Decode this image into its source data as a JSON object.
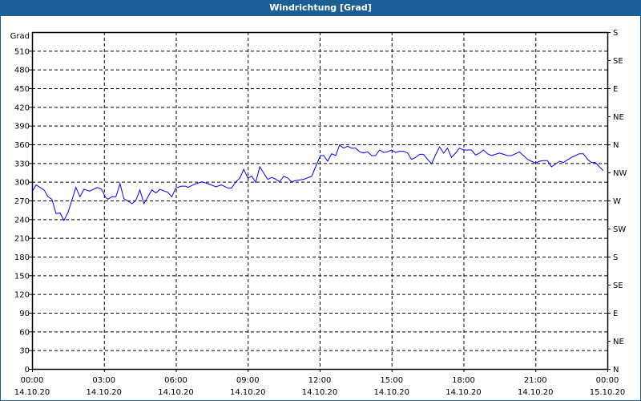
{
  "window": {
    "title": "Windrichtung [Grad]"
  },
  "chart_data": {
    "type": "line",
    "title": "Windrichtung [Grad]",
    "ylabel": "Grad",
    "ylim": [
      0,
      540
    ],
    "y_ticks": [
      0,
      30,
      60,
      90,
      120,
      150,
      180,
      210,
      240,
      270,
      300,
      330,
      360,
      390,
      420,
      450,
      480,
      510
    ],
    "right_axis": [
      {
        "value": 540,
        "label": "S"
      },
      {
        "value": 495,
        "label": "SE"
      },
      {
        "value": 450,
        "label": "E"
      },
      {
        "value": 405,
        "label": "NE"
      },
      {
        "value": 360,
        "label": "N"
      },
      {
        "value": 315,
        "label": "NW"
      },
      {
        "value": 270,
        "label": "W"
      },
      {
        "value": 225,
        "label": "SW"
      },
      {
        "value": 180,
        "label": "S"
      },
      {
        "value": 135,
        "label": "SE"
      },
      {
        "value": 90,
        "label": "E"
      },
      {
        "value": 45,
        "label": "NE"
      },
      {
        "value": 0,
        "label": "N"
      }
    ],
    "xlim_hours": [
      0,
      24
    ],
    "x_ticks": [
      {
        "hour": 0,
        "time": "00:00",
        "date": "14.10.20"
      },
      {
        "hour": 3,
        "time": "03:00",
        "date": "14.10.20"
      },
      {
        "hour": 6,
        "time": "06:00",
        "date": "14.10.20"
      },
      {
        "hour": 9,
        "time": "09:00",
        "date": "14.10.20"
      },
      {
        "hour": 12,
        "time": "12:00",
        "date": "14.10.20"
      },
      {
        "hour": 15,
        "time": "15:00",
        "date": "14.10.20"
      },
      {
        "hour": 18,
        "time": "18:00",
        "date": "14.10.20"
      },
      {
        "hour": 21,
        "time": "21:00",
        "date": "14.10.20"
      },
      {
        "hour": 24,
        "time": "00:00",
        "date": "15.10.20"
      }
    ],
    "grid": true,
    "series": [
      {
        "name": "Windrichtung",
        "color": "#0000ff",
        "points": [
          [
            0,
            284
          ],
          [
            0.17,
            295
          ],
          [
            0.33,
            291
          ],
          [
            0.5,
            287
          ],
          [
            0.67,
            276
          ],
          [
            0.83,
            272
          ],
          [
            1,
            249
          ],
          [
            1.17,
            250
          ],
          [
            1.33,
            238
          ],
          [
            1.5,
            251
          ],
          [
            1.83,
            291
          ],
          [
            2,
            276
          ],
          [
            2.17,
            288
          ],
          [
            2.4,
            285
          ],
          [
            2.73,
            291
          ],
          [
            2.9,
            288
          ],
          [
            3.07,
            275
          ],
          [
            3.17,
            272
          ],
          [
            3.33,
            276
          ],
          [
            3.5,
            276
          ],
          [
            3.67,
            297
          ],
          [
            3.83,
            273
          ],
          [
            4.17,
            265
          ],
          [
            4.33,
            270
          ],
          [
            4.5,
            287
          ],
          [
            4.67,
            265
          ],
          [
            5,
            287
          ],
          [
            5.17,
            282
          ],
          [
            5.33,
            288
          ],
          [
            5.67,
            283
          ],
          [
            5.83,
            276
          ],
          [
            6,
            290
          ],
          [
            6.23,
            293
          ],
          [
            6.4,
            293
          ],
          [
            6.5,
            291
          ],
          [
            6.77,
            296
          ],
          [
            7.1,
            300
          ],
          [
            7.33,
            297
          ],
          [
            7.67,
            292
          ],
          [
            7.9,
            295
          ],
          [
            8.17,
            290
          ],
          [
            8.33,
            290
          ],
          [
            8.5,
            300
          ],
          [
            8.67,
            306
          ],
          [
            8.83,
            320
          ],
          [
            9,
            306
          ],
          [
            9.17,
            309
          ],
          [
            9.33,
            299
          ],
          [
            9.5,
            324
          ],
          [
            9.83,
            304
          ],
          [
            10,
            307
          ],
          [
            10.17,
            304
          ],
          [
            10.33,
            300
          ],
          [
            10.5,
            309
          ],
          [
            10.67,
            306
          ],
          [
            10.83,
            300
          ],
          [
            11,
            302
          ],
          [
            11.33,
            304
          ],
          [
            11.67,
            309
          ],
          [
            11.83,
            324
          ],
          [
            12.03,
            342
          ],
          [
            12.17,
            342
          ],
          [
            12.33,
            333
          ],
          [
            12.5,
            345
          ],
          [
            12.67,
            342
          ],
          [
            12.83,
            359
          ],
          [
            13,
            354
          ],
          [
            13.17,
            357
          ],
          [
            13.33,
            354
          ],
          [
            13.5,
            354
          ],
          [
            13.67,
            348
          ],
          [
            13.83,
            346
          ],
          [
            14,
            348
          ],
          [
            14.17,
            342
          ],
          [
            14.33,
            342
          ],
          [
            14.5,
            351
          ],
          [
            14.67,
            347
          ],
          [
            14.83,
            348
          ],
          [
            15,
            351
          ],
          [
            15.17,
            347
          ],
          [
            15.33,
            349
          ],
          [
            15.5,
            349
          ],
          [
            15.67,
            346
          ],
          [
            15.83,
            336
          ],
          [
            16,
            339
          ],
          [
            16.17,
            344
          ],
          [
            16.33,
            344
          ],
          [
            16.5,
            336
          ],
          [
            16.67,
            329
          ],
          [
            16.83,
            343
          ],
          [
            17,
            356
          ],
          [
            17.17,
            346
          ],
          [
            17.33,
            354
          ],
          [
            17.5,
            339
          ],
          [
            17.67,
            346
          ],
          [
            17.83,
            354
          ],
          [
            18,
            351
          ],
          [
            18.17,
            351
          ],
          [
            18.33,
            351
          ],
          [
            18.5,
            343
          ],
          [
            18.67,
            346
          ],
          [
            18.83,
            351
          ],
          [
            19,
            345
          ],
          [
            19.17,
            342
          ],
          [
            19.33,
            344
          ],
          [
            19.5,
            346
          ],
          [
            19.67,
            344
          ],
          [
            19.83,
            342
          ],
          [
            20,
            342
          ],
          [
            20.17,
            345
          ],
          [
            20.33,
            348
          ],
          [
            20.5,
            342
          ],
          [
            20.67,
            336
          ],
          [
            20.83,
            333
          ],
          [
            21,
            330
          ],
          [
            21.17,
            333
          ],
          [
            21.33,
            334
          ],
          [
            21.5,
            334
          ],
          [
            21.67,
            324
          ],
          [
            21.83,
            328
          ],
          [
            22,
            333
          ],
          [
            22.17,
            331
          ],
          [
            22.33,
            335
          ],
          [
            22.5,
            339
          ],
          [
            22.67,
            342
          ],
          [
            22.83,
            345
          ],
          [
            23,
            345
          ],
          [
            23.17,
            336
          ],
          [
            23.33,
            331
          ],
          [
            23.5,
            331
          ],
          [
            23.67,
            324
          ],
          [
            23.83,
            318
          ]
        ]
      }
    ]
  }
}
